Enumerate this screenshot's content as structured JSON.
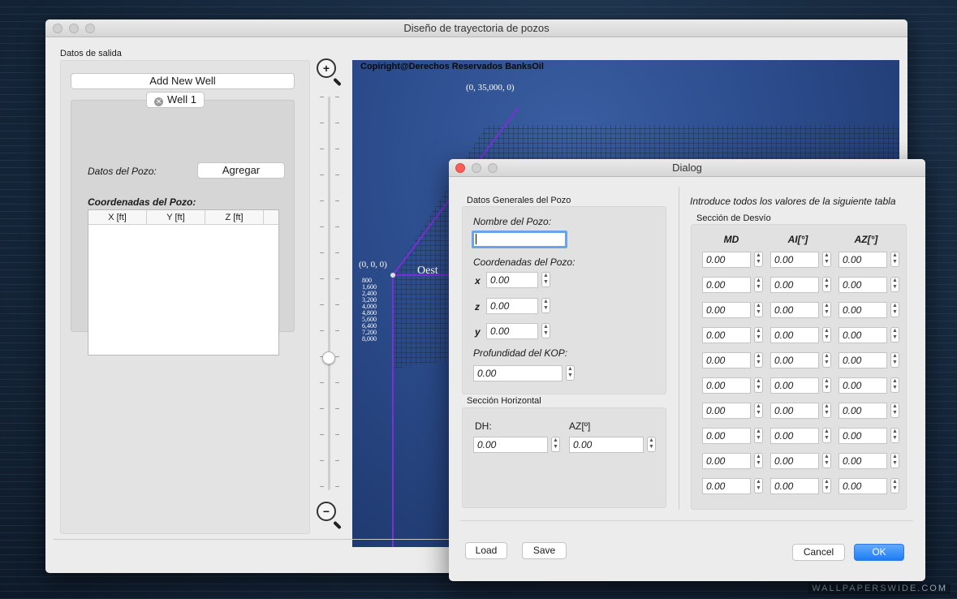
{
  "main_window": {
    "title": "Diseño de trayectoria de pozos",
    "group_label": "Datos de salida",
    "add_well_label": "Add New Well",
    "well_tab_label": "Well 1",
    "datos_pozo_label": "Datos del Pozo:",
    "agregar_label": "Agregar",
    "coordenadas_label": "Coordenadas del Pozo:",
    "coord_columns": [
      "X [ft]",
      "Y [ft]",
      "Z [ft]"
    ],
    "zoom_in_icon": "zoom-in-icon",
    "zoom_out_icon": "zoom-out-icon",
    "zoom_level": 0.35
  },
  "view3d": {
    "copyright": "Copiright@Derechos Reservados BanksOil",
    "top_label": "(0, 35,000, 0)",
    "origin_label": "(0, 0, 0)",
    "west_label": "Oest",
    "depth_ticks": [
      "800",
      "1,600",
      "2,400",
      "3,200",
      "4,000",
      "4,800",
      "5,600",
      "6,400",
      "7,200",
      "8,000"
    ]
  },
  "dialog": {
    "title": "Dialog",
    "general_section": "Datos Generales del Pozo",
    "nombre_label": "Nombre del Pozo:",
    "nombre_value": "",
    "coords_label": "Coordenadas del Pozo:",
    "x_label": "x",
    "x_value": "0.00",
    "z_label": "z",
    "z_value": "0.00",
    "y_label": "y",
    "y_value": "0.00",
    "kop_label": "Profundidad del KOP:",
    "kop_value": "0.00",
    "horizontal_section": "Sección Horizontal",
    "dh_label": "DH:",
    "dh_value": "0.00",
    "az_label": "AZ[º]",
    "az_value": "0.00",
    "table_instruction": "Introduce todos los valores de la siguiente tabla",
    "desvio_section": "Sección de Desvío",
    "table_headers": [
      "MD",
      "AI[°]",
      "AZ[°]"
    ],
    "table_rows": [
      [
        "0.00",
        "0.00",
        "0.00"
      ],
      [
        "0.00",
        "0.00",
        "0.00"
      ],
      [
        "0.00",
        "0.00",
        "0.00"
      ],
      [
        "0.00",
        "0.00",
        "0.00"
      ],
      [
        "0.00",
        "0.00",
        "0.00"
      ],
      [
        "0.00",
        "0.00",
        "0.00"
      ],
      [
        "0.00",
        "0.00",
        "0.00"
      ],
      [
        "0.00",
        "0.00",
        "0.00"
      ],
      [
        "0.00",
        "0.00",
        "0.00"
      ],
      [
        "0.00",
        "0.00",
        "0.00"
      ]
    ],
    "load_label": "Load",
    "save_label": "Save",
    "cancel_label": "Cancel",
    "ok_label": "OK"
  },
  "desktop": {
    "wallpaper_tag": "WALLPAPERSWIDE.COM"
  },
  "colors": {
    "accent": "#1d7df3",
    "view_bg": "#2b4b8b",
    "trajectory": "#7b2fd6"
  }
}
